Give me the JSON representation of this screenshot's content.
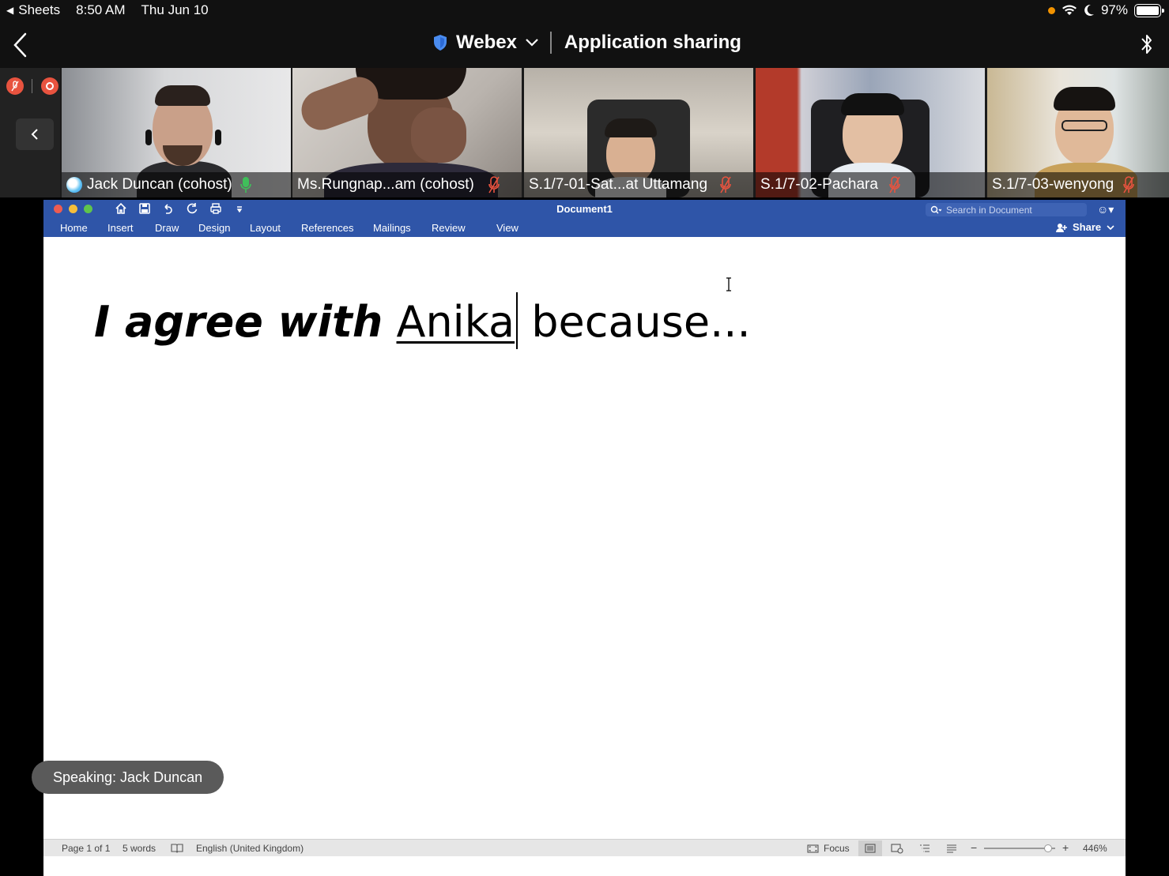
{
  "status_bar": {
    "back_app": "Sheets",
    "time": "8:50 AM",
    "date": "Thu Jun 10",
    "battery": "97%"
  },
  "header": {
    "app_name": "Webex",
    "mode": "Application sharing"
  },
  "participants": [
    {
      "name": "Jack Duncan (cohost)",
      "mic": "active"
    },
    {
      "name": "Ms.Rungnap...am (cohost)",
      "mic": "muted"
    },
    {
      "name": "S.1/7-01-Sat...at Uttamang",
      "mic": "muted"
    },
    {
      "name": "S.1/7-02-Pachara",
      "mic": "muted"
    },
    {
      "name": "S.1/7-03-wenyong",
      "mic": "muted"
    }
  ],
  "word": {
    "doc_title": "Document1",
    "search_placeholder": "Search in Document",
    "tabs": [
      "Home",
      "Insert",
      "Draw",
      "Design",
      "Layout",
      "References",
      "Mailings",
      "Review",
      "View"
    ],
    "share_label": "Share",
    "content": {
      "part1": "I agree with",
      "part2": "Anika",
      "part3": "because..."
    },
    "statusbar": {
      "page": "Page 1 of 1",
      "words": "5 words",
      "language": "English (United Kingdom)",
      "focus": "Focus",
      "zoom": "446%"
    }
  },
  "speaking_indicator": "Speaking: Jack Duncan",
  "colors": {
    "ribbon": "#2f55a8",
    "mute_red": "#e8533f",
    "mic_active": "#3fbf5a"
  }
}
